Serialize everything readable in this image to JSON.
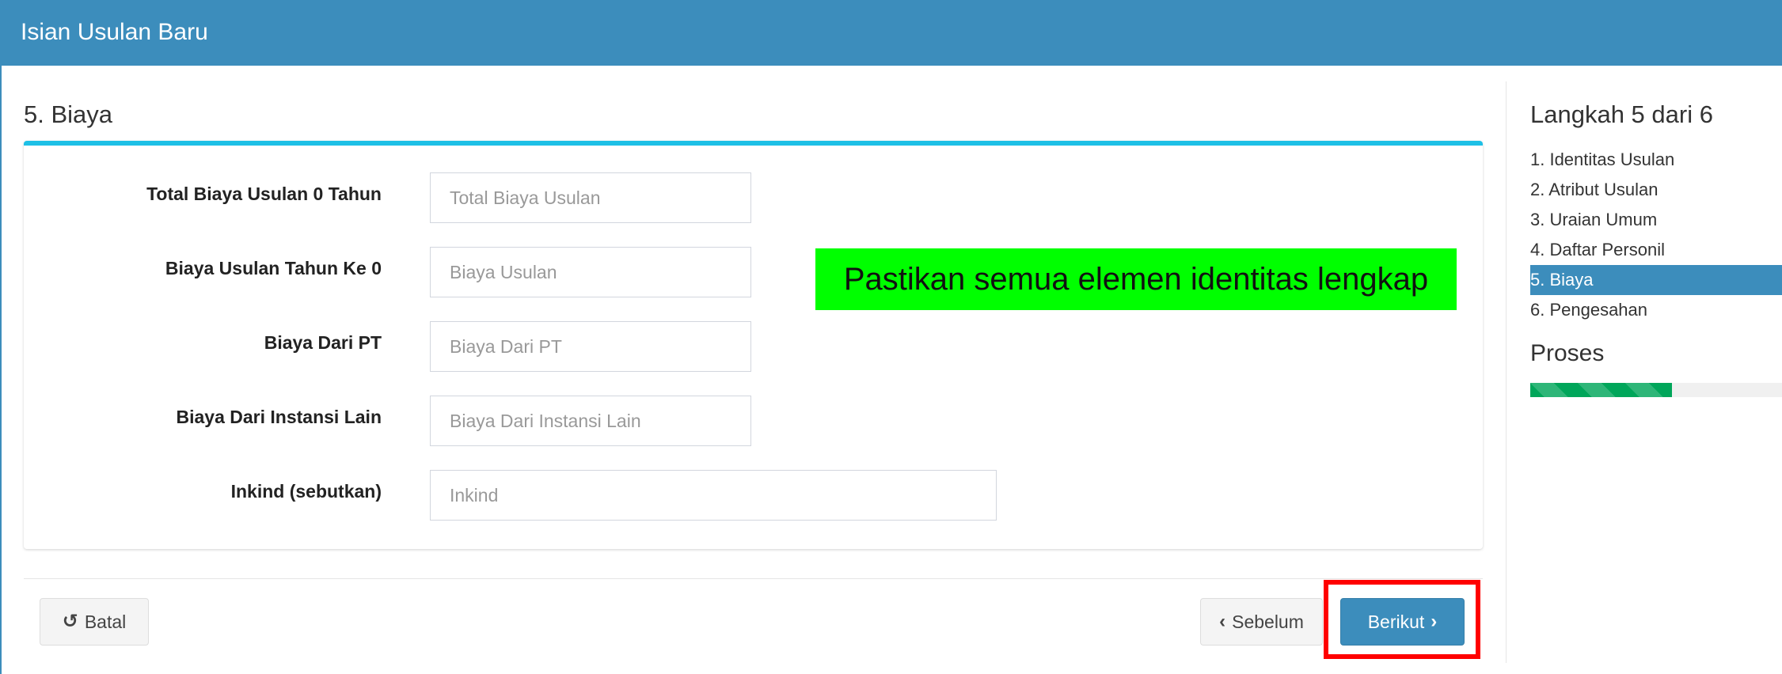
{
  "header": {
    "title": "Isian Usulan Baru"
  },
  "section": {
    "title": "5. Biaya"
  },
  "form": {
    "fields": [
      {
        "label": "Total Biaya Usulan 0 Tahun",
        "placeholder": "Total Biaya Usulan",
        "value": ""
      },
      {
        "label": "Biaya Usulan Tahun Ke 0",
        "placeholder": "Biaya Usulan",
        "value": ""
      },
      {
        "label": "Biaya Dari PT",
        "placeholder": "Biaya Dari PT",
        "value": ""
      },
      {
        "label": "Biaya Dari Instansi Lain",
        "placeholder": "Biaya Dari Instansi Lain",
        "value": ""
      },
      {
        "label": "Inkind (sebutkan)",
        "placeholder": "Inkind",
        "value": ""
      }
    ]
  },
  "note": "Pastikan semua elemen identitas lengkap",
  "buttons": {
    "cancel_label": "Batal",
    "prev_label": "Sebelum",
    "next_label": "Berikut"
  },
  "steps": {
    "heading": "Langkah 5 dari 6",
    "items": [
      "1. Identitas Usulan",
      "2. Atribut Usulan",
      "3. Uraian Umum",
      "4. Daftar Personil",
      "5. Biaya",
      "6. Pengesahan"
    ],
    "active_index": 4,
    "progress_label": "Proses",
    "progress_fraction": 0.56
  },
  "colors": {
    "header": "#3c8dbc",
    "accent_line": "#1ec0e6",
    "primary_button": "#3c8dbc",
    "progress_bar": "#00a65a",
    "note_background": "#00ff00",
    "highlight_border": "#ff0000"
  },
  "icons": {
    "cancel": "undo-icon",
    "prev": "chevron-left-icon",
    "next": "chevron-right-icon"
  }
}
